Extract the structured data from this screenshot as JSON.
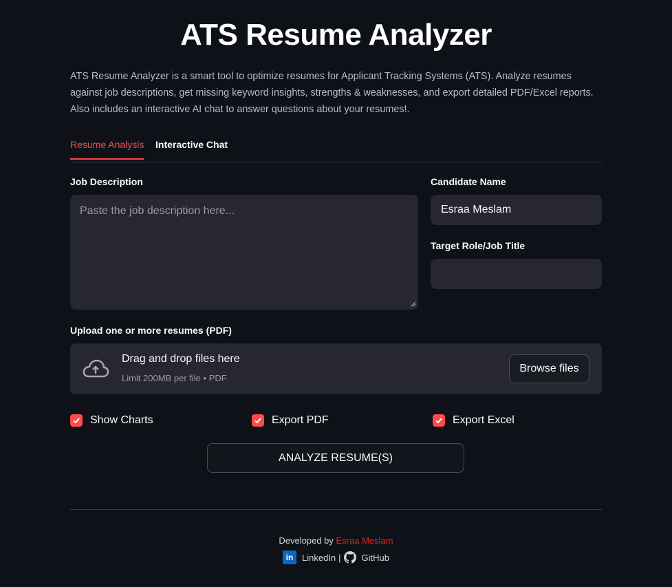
{
  "app": {
    "title": "ATS Resume Analyzer",
    "description": "ATS Resume Analyzer is a smart tool to optimize resumes for Applicant Tracking Systems (ATS). Analyze resumes against job descriptions, get missing keyword insights, strengths & weaknesses, and export detailed PDF/Excel reports. Also includes an interactive AI chat to answer questions about your resumes!."
  },
  "tabs": [
    {
      "label": "Resume Analysis",
      "active": true
    },
    {
      "label": "Interactive Chat",
      "active": false
    }
  ],
  "form": {
    "job_description_label": "Job Description",
    "job_description_placeholder": "Paste the job description here...",
    "job_description_value": "",
    "candidate_name_label": "Candidate Name",
    "candidate_name_value": "Esraa Meslam",
    "target_role_label": "Target Role/Job Title",
    "target_role_value": ""
  },
  "upload": {
    "label": "Upload one or more resumes (PDF)",
    "drop_title": "Drag and drop files here",
    "limit_text": "Limit 200MB per file • PDF",
    "browse_label": "Browse files",
    "icon": "cloud-upload-icon"
  },
  "options": [
    {
      "label": "Show Charts",
      "checked": true
    },
    {
      "label": "Export PDF",
      "checked": true
    },
    {
      "label": "Export Excel",
      "checked": true
    }
  ],
  "analyze_label": "ANALYZE RESUME(S)",
  "footer": {
    "developed_by": "Developed by",
    "author": "Esraa Meslam",
    "linkedin_label": "LinkedIn",
    "separator": "|",
    "github_label": "GitHub"
  },
  "colors": {
    "background": "#0e1117",
    "accent": "#ff4b4b",
    "field": "#262730",
    "author": "#e02424",
    "linkedin": "#0a66c2"
  }
}
